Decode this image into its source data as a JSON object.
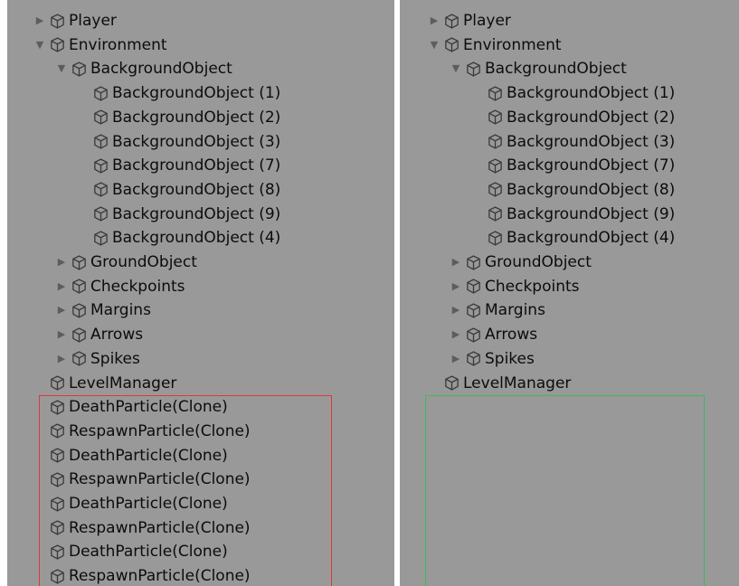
{
  "left_panel": {
    "rows": [
      {
        "label": "Player",
        "depth": 0,
        "arrow": "collapsed"
      },
      {
        "label": "Environment",
        "depth": 0,
        "arrow": "expanded"
      },
      {
        "label": "BackgroundObject",
        "depth": 1,
        "arrow": "expanded"
      },
      {
        "label": "BackgroundObject (1)",
        "depth": 2,
        "arrow": "none"
      },
      {
        "label": "BackgroundObject (2)",
        "depth": 2,
        "arrow": "none"
      },
      {
        "label": "BackgroundObject (3)",
        "depth": 2,
        "arrow": "none"
      },
      {
        "label": "BackgroundObject (7)",
        "depth": 2,
        "arrow": "none"
      },
      {
        "label": "BackgroundObject (8)",
        "depth": 2,
        "arrow": "none"
      },
      {
        "label": "BackgroundObject (9)",
        "depth": 2,
        "arrow": "none"
      },
      {
        "label": "BackgroundObject (4)",
        "depth": 2,
        "arrow": "none"
      },
      {
        "label": "GroundObject",
        "depth": 1,
        "arrow": "collapsed"
      },
      {
        "label": "Checkpoints",
        "depth": 1,
        "arrow": "collapsed"
      },
      {
        "label": "Margins",
        "depth": 1,
        "arrow": "collapsed"
      },
      {
        "label": "Arrows",
        "depth": 1,
        "arrow": "collapsed"
      },
      {
        "label": "Spikes",
        "depth": 1,
        "arrow": "collapsed"
      },
      {
        "label": "LevelManager",
        "depth": 0,
        "arrow": "none"
      },
      {
        "label": "DeathParticle(Clone)",
        "depth": 0,
        "arrow": "none"
      },
      {
        "label": "RespawnParticle(Clone)",
        "depth": 0,
        "arrow": "none"
      },
      {
        "label": "DeathParticle(Clone)",
        "depth": 0,
        "arrow": "none"
      },
      {
        "label": "RespawnParticle(Clone)",
        "depth": 0,
        "arrow": "none"
      },
      {
        "label": "DeathParticle(Clone)",
        "depth": 0,
        "arrow": "none"
      },
      {
        "label": "RespawnParticle(Clone)",
        "depth": 0,
        "arrow": "none"
      },
      {
        "label": "DeathParticle(Clone)",
        "depth": 0,
        "arrow": "none"
      },
      {
        "label": "RespawnParticle(Clone)",
        "depth": 0,
        "arrow": "none"
      }
    ],
    "highlight_color": "#e0383b"
  },
  "right_panel": {
    "rows": [
      {
        "label": "Player",
        "depth": 0,
        "arrow": "collapsed"
      },
      {
        "label": "Environment",
        "depth": 0,
        "arrow": "expanded"
      },
      {
        "label": "BackgroundObject",
        "depth": 1,
        "arrow": "expanded"
      },
      {
        "label": "BackgroundObject (1)",
        "depth": 2,
        "arrow": "none"
      },
      {
        "label": "BackgroundObject (2)",
        "depth": 2,
        "arrow": "none"
      },
      {
        "label": "BackgroundObject (3)",
        "depth": 2,
        "arrow": "none"
      },
      {
        "label": "BackgroundObject (7)",
        "depth": 2,
        "arrow": "none"
      },
      {
        "label": "BackgroundObject (8)",
        "depth": 2,
        "arrow": "none"
      },
      {
        "label": "BackgroundObject (9)",
        "depth": 2,
        "arrow": "none"
      },
      {
        "label": "BackgroundObject (4)",
        "depth": 2,
        "arrow": "none"
      },
      {
        "label": "GroundObject",
        "depth": 1,
        "arrow": "collapsed"
      },
      {
        "label": "Checkpoints",
        "depth": 1,
        "arrow": "collapsed"
      },
      {
        "label": "Margins",
        "depth": 1,
        "arrow": "collapsed"
      },
      {
        "label": "Arrows",
        "depth": 1,
        "arrow": "collapsed"
      },
      {
        "label": "Spikes",
        "depth": 1,
        "arrow": "collapsed"
      },
      {
        "label": "LevelManager",
        "depth": 0,
        "arrow": "none"
      }
    ],
    "highlight_color": "#3dbb58"
  },
  "colors": {
    "panel_bg": "#999999",
    "text": "#0c0c0c",
    "icon": "#3a3a3a"
  },
  "icons": {
    "gameobject": "cube-icon",
    "expanded": "triangle-down-icon",
    "collapsed": "triangle-right-icon"
  }
}
